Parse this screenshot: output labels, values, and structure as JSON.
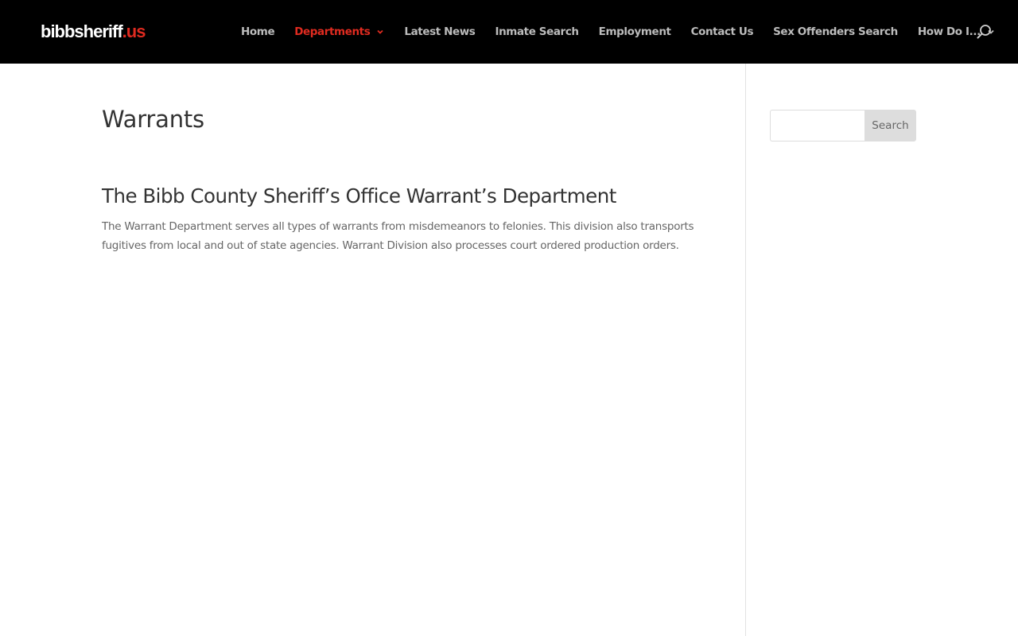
{
  "header": {
    "logo_part1": "bibbsheriff",
    "logo_part2": ".us",
    "nav": [
      {
        "label": "Home",
        "has_dropdown": false
      },
      {
        "label": "Departments",
        "has_dropdown": true,
        "active": true
      },
      {
        "label": "Latest News",
        "has_dropdown": false
      },
      {
        "label": "Inmate Search",
        "has_dropdown": false
      },
      {
        "label": "Employment",
        "has_dropdown": false
      },
      {
        "label": "Contact Us",
        "has_dropdown": false
      },
      {
        "label": "Sex Offenders Search",
        "has_dropdown": false
      },
      {
        "label": "How Do I...",
        "has_dropdown": true
      }
    ],
    "search_icon": "magnifier-icon"
  },
  "main": {
    "page_title": "Warrants",
    "section_heading": "The Bibb County Sheriff’s Office Warrant’s Department",
    "body": "The Warrant Department serves all types of warrants from misdemeanors to felonies. This division also transports fugitives from local and out of state agencies. Warrant Division also processes court ordered production orders."
  },
  "sidebar": {
    "search": {
      "value": "",
      "placeholder": "",
      "button_label": "Search"
    }
  },
  "colors": {
    "header_bg": "#000000",
    "nav_text": "#bcbcbc",
    "accent": "#e02b20",
    "heading_text": "#333333",
    "body_text": "#666666"
  }
}
